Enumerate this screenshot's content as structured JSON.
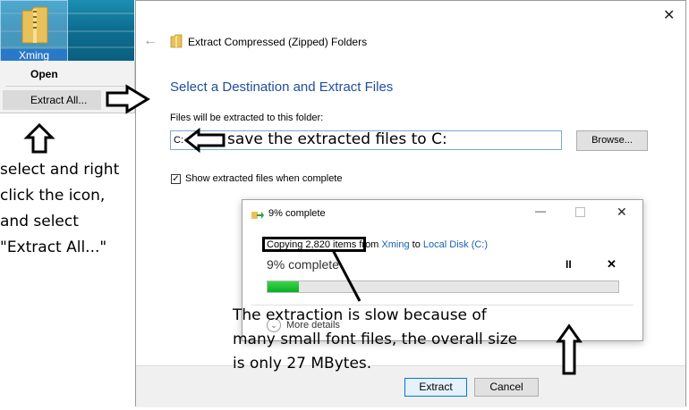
{
  "desktop": {
    "icon_label": "Xming"
  },
  "context_menu": {
    "open_label": "Open",
    "extract_label": "Extract All..."
  },
  "annotations": {
    "left_note": "select and right click the icon, and select \"Extract All...\"",
    "dest_note": "save the extracted files to C:",
    "slow_note": "The extraction is slow because of many small font files, the overall size is only 27 MBytes."
  },
  "wizard": {
    "close_glyph": "✕",
    "back_glyph": "←",
    "title": "Extract Compressed (Zipped) Folders",
    "heading": "Select a Destination and Extract Files",
    "dest_label": "Files will be extracted to this folder:",
    "dest_value": "C:",
    "browse_label": "Browse...",
    "show_files_checked": true,
    "show_files_label": "Show extracted files when complete",
    "extract_label": "Extract",
    "cancel_label": "Cancel"
  },
  "progress_dialog": {
    "title": "9% complete",
    "copy_prefix": "Copying 2,820 items",
    "copy_from_word": "from",
    "source": "Xming",
    "copy_to_word": "to",
    "destination": "Local Disk (C:)",
    "percent_text": "9% complete",
    "progress_fraction": 0.09,
    "more_details_label": "More details",
    "pause_glyph": "II",
    "stop_glyph": "✕",
    "min_glyph": "—",
    "close_glyph": "✕"
  },
  "colors": {
    "accent_blue": "#1f4e9c",
    "link_blue": "#1a5fb4",
    "progress_green": "#06b025",
    "primary_button_border": "#0078d7"
  }
}
